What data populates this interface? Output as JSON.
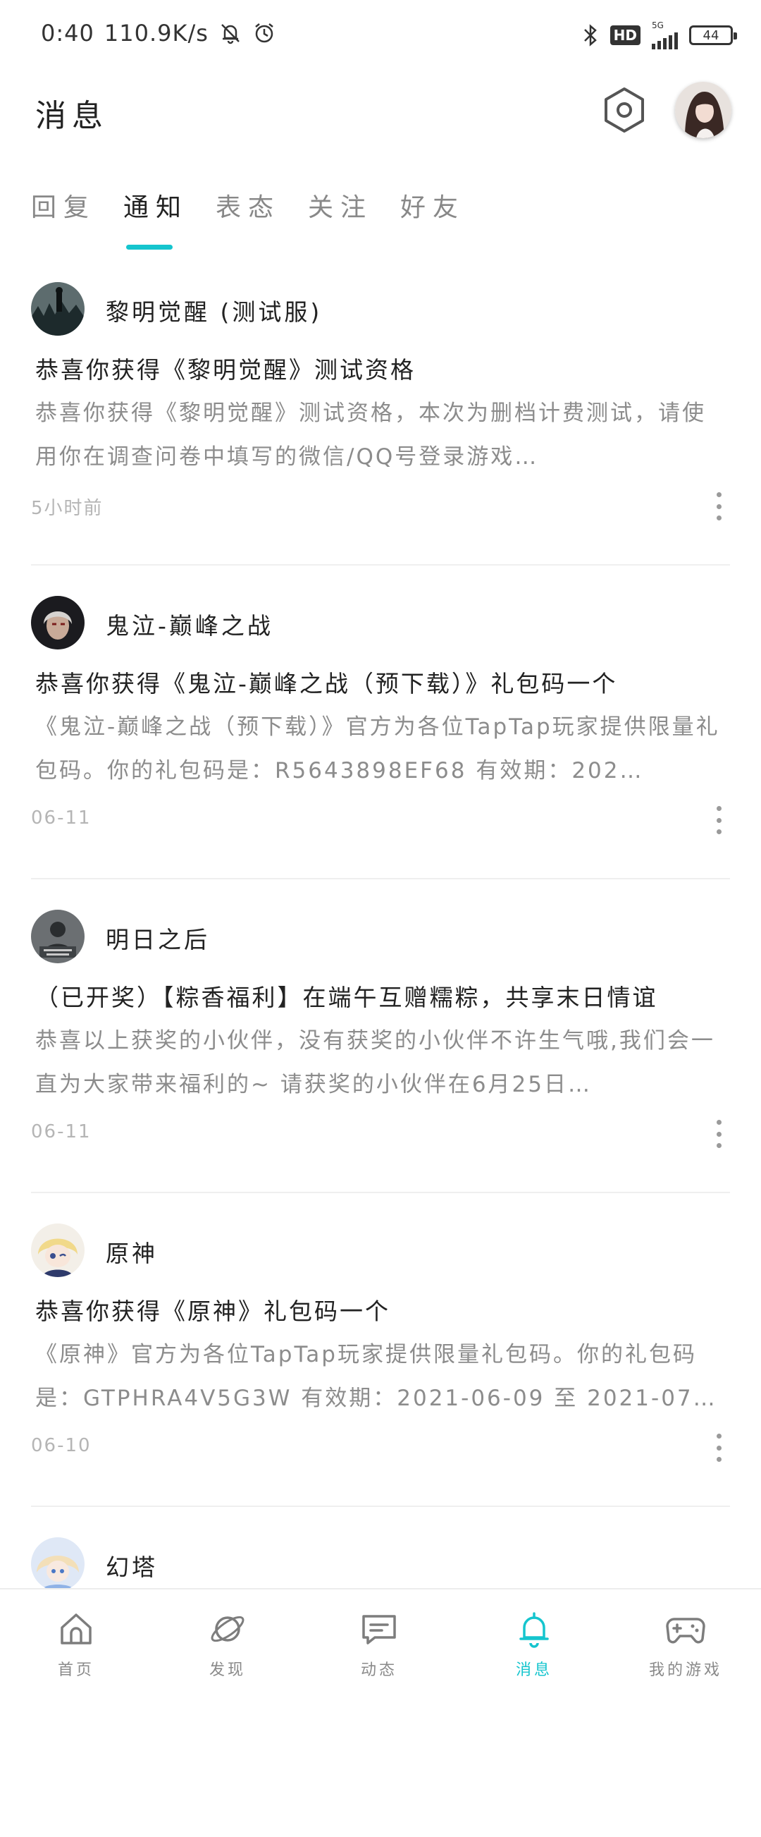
{
  "status_bar": {
    "time": "0:40",
    "speed": "110.9K/s",
    "network": "5G",
    "hd": "HD",
    "battery": "44"
  },
  "header": {
    "title": "消息"
  },
  "tabs": [
    {
      "label": "回复",
      "active": false
    },
    {
      "label": "通知",
      "active": true
    },
    {
      "label": "表态",
      "active": false
    },
    {
      "label": "关注",
      "active": false
    },
    {
      "label": "好友",
      "active": false
    }
  ],
  "notifications": [
    {
      "source": "黎明觉醒 (测试服)",
      "title": "恭喜你获得《黎明觉醒》测试资格",
      "body": "恭喜你获得《黎明觉醒》测试资格，本次为删档计费测试，请使用你在调查问卷中填写的微信/QQ号登录游戏…",
      "time": "5小时前"
    },
    {
      "source": "鬼泣-巅峰之战",
      "title": "恭喜你获得《鬼泣-巅峰之战（预下载）》礼包码一个",
      "body": "《鬼泣-巅峰之战（预下载）》官方为各位TapTap玩家提供限量礼包码。你的礼包码是：R5643898EF68 有效期：202…",
      "time": "06-11"
    },
    {
      "source": "明日之后",
      "title": "（已开奖）【粽香福利】在端午互赠糯粽，共享末日情谊",
      "body": "恭喜以上获奖的小伙伴，没有获奖的小伙伴不许生气哦,我们会一直为大家带来福利的~ 请获奖的小伙伴在6月25日…",
      "time": "06-11"
    },
    {
      "source": "原神",
      "title": "恭喜你获得《原神》礼包码一个",
      "body": "《原神》官方为各位TapTap玩家提供限量礼包码。你的礼包码是：GTPHRA4V5G3W 有效期：2021-06-09 至 2021-07…",
      "time": "06-10"
    },
    {
      "source": "幻塔",
      "title": "",
      "body": "",
      "time": ""
    }
  ],
  "bottom_nav": [
    {
      "label": "首页",
      "icon": "home-icon",
      "active": false
    },
    {
      "label": "发现",
      "icon": "discover-planet-icon",
      "active": false
    },
    {
      "label": "动态",
      "icon": "feed-chat-icon",
      "active": false
    },
    {
      "label": "消息",
      "icon": "bell-icon",
      "active": true
    },
    {
      "label": "我的游戏",
      "icon": "gamepad-icon",
      "active": false
    }
  ],
  "colors": {
    "accent": "#15c5ce",
    "text": "#222222",
    "muted": "#8c8c8c"
  }
}
